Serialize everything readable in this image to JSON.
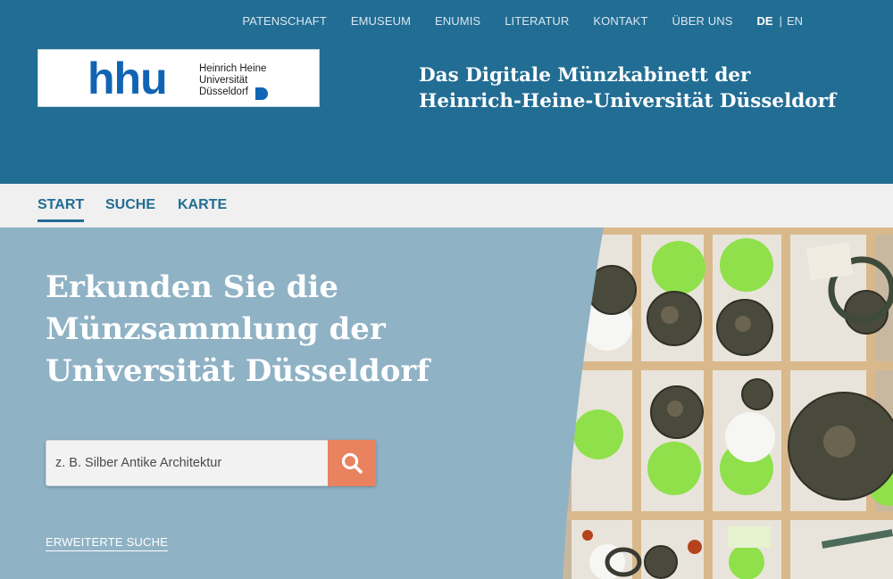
{
  "topnav": {
    "items": [
      "PATENSCHAFT",
      "EMUSEUM",
      "ENUMIS",
      "LITERATUR",
      "KONTAKT",
      "ÜBER UNS"
    ],
    "lang_de": "DE",
    "lang_sep": "|",
    "lang_en": "EN"
  },
  "logo": {
    "mark": "hhu",
    "line1": "Heinrich Heine",
    "line2": "Universität",
    "line3": "Düsseldorf"
  },
  "site_title": {
    "line1": "Das Digitale Münzkabinett der",
    "line2": "Heinrich-Heine-Universität Düsseldorf"
  },
  "mainnav": {
    "start": "START",
    "suche": "SUCHE",
    "karte": "KARTE"
  },
  "hero": {
    "heading_line1": "Erkunden Sie die",
    "heading_line2": "Münzsammlung der",
    "heading_line3": "Universität Düsseldorf",
    "search_placeholder": "z. B. Silber Antike Architektur",
    "advanced_search": "ERWEITERTE SUCHE"
  },
  "colors": {
    "header_bg": "#226d94",
    "nav_bg": "#f0f0f0",
    "hero_bg": "#8fb2c5",
    "search_button": "#e8825f",
    "logo_blue": "#1164b4"
  },
  "icons": {
    "search": "search-icon",
    "logo_mark": "hhu-logo-mark"
  }
}
